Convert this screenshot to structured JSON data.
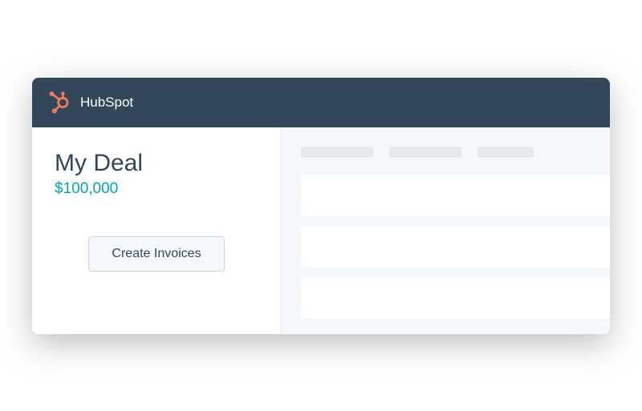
{
  "header": {
    "brand": "HubSpot"
  },
  "deal": {
    "title": "My Deal",
    "amount": "$100,000"
  },
  "actions": {
    "create_invoices_label": "Create Invoices"
  }
}
